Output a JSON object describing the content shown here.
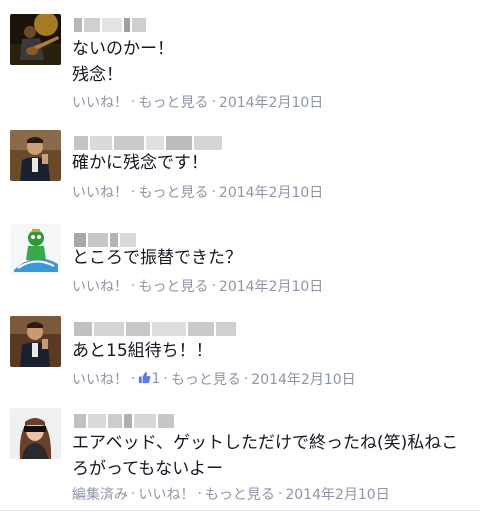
{
  "comments": [
    {
      "text": "ないのかー！\n残念！",
      "like_label": "いいね！",
      "more_label": "もっと見る",
      "date": "2014年2月10日"
    },
    {
      "text": "確かに残念です！",
      "like_label": "いいね！",
      "more_label": "もっと見る",
      "date": "2014年2月10日"
    },
    {
      "text": "ところで振替できた？",
      "like_label": "いいね！",
      "more_label": "もっと見る",
      "date": "2014年2月10日"
    },
    {
      "text": "あと15組待ち！！",
      "like_label": "いいね！",
      "like_count": "1",
      "more_label": "もっと見る",
      "date": "2014年2月10日"
    },
    {
      "text": "エアベッド、ゲットしただけで終ったね(笑)私ねころがってもないよー",
      "edited_label": "編集済み",
      "like_label": "いいね！",
      "more_label": "もっと見る",
      "date": "2014年2月10日"
    }
  ],
  "separator": "·",
  "colors": {
    "meta_text": "#8e95a6",
    "body_text": "#141823",
    "like_icon": "#5b7bd5"
  },
  "icons": {
    "like": "thumbs-up-icon"
  }
}
